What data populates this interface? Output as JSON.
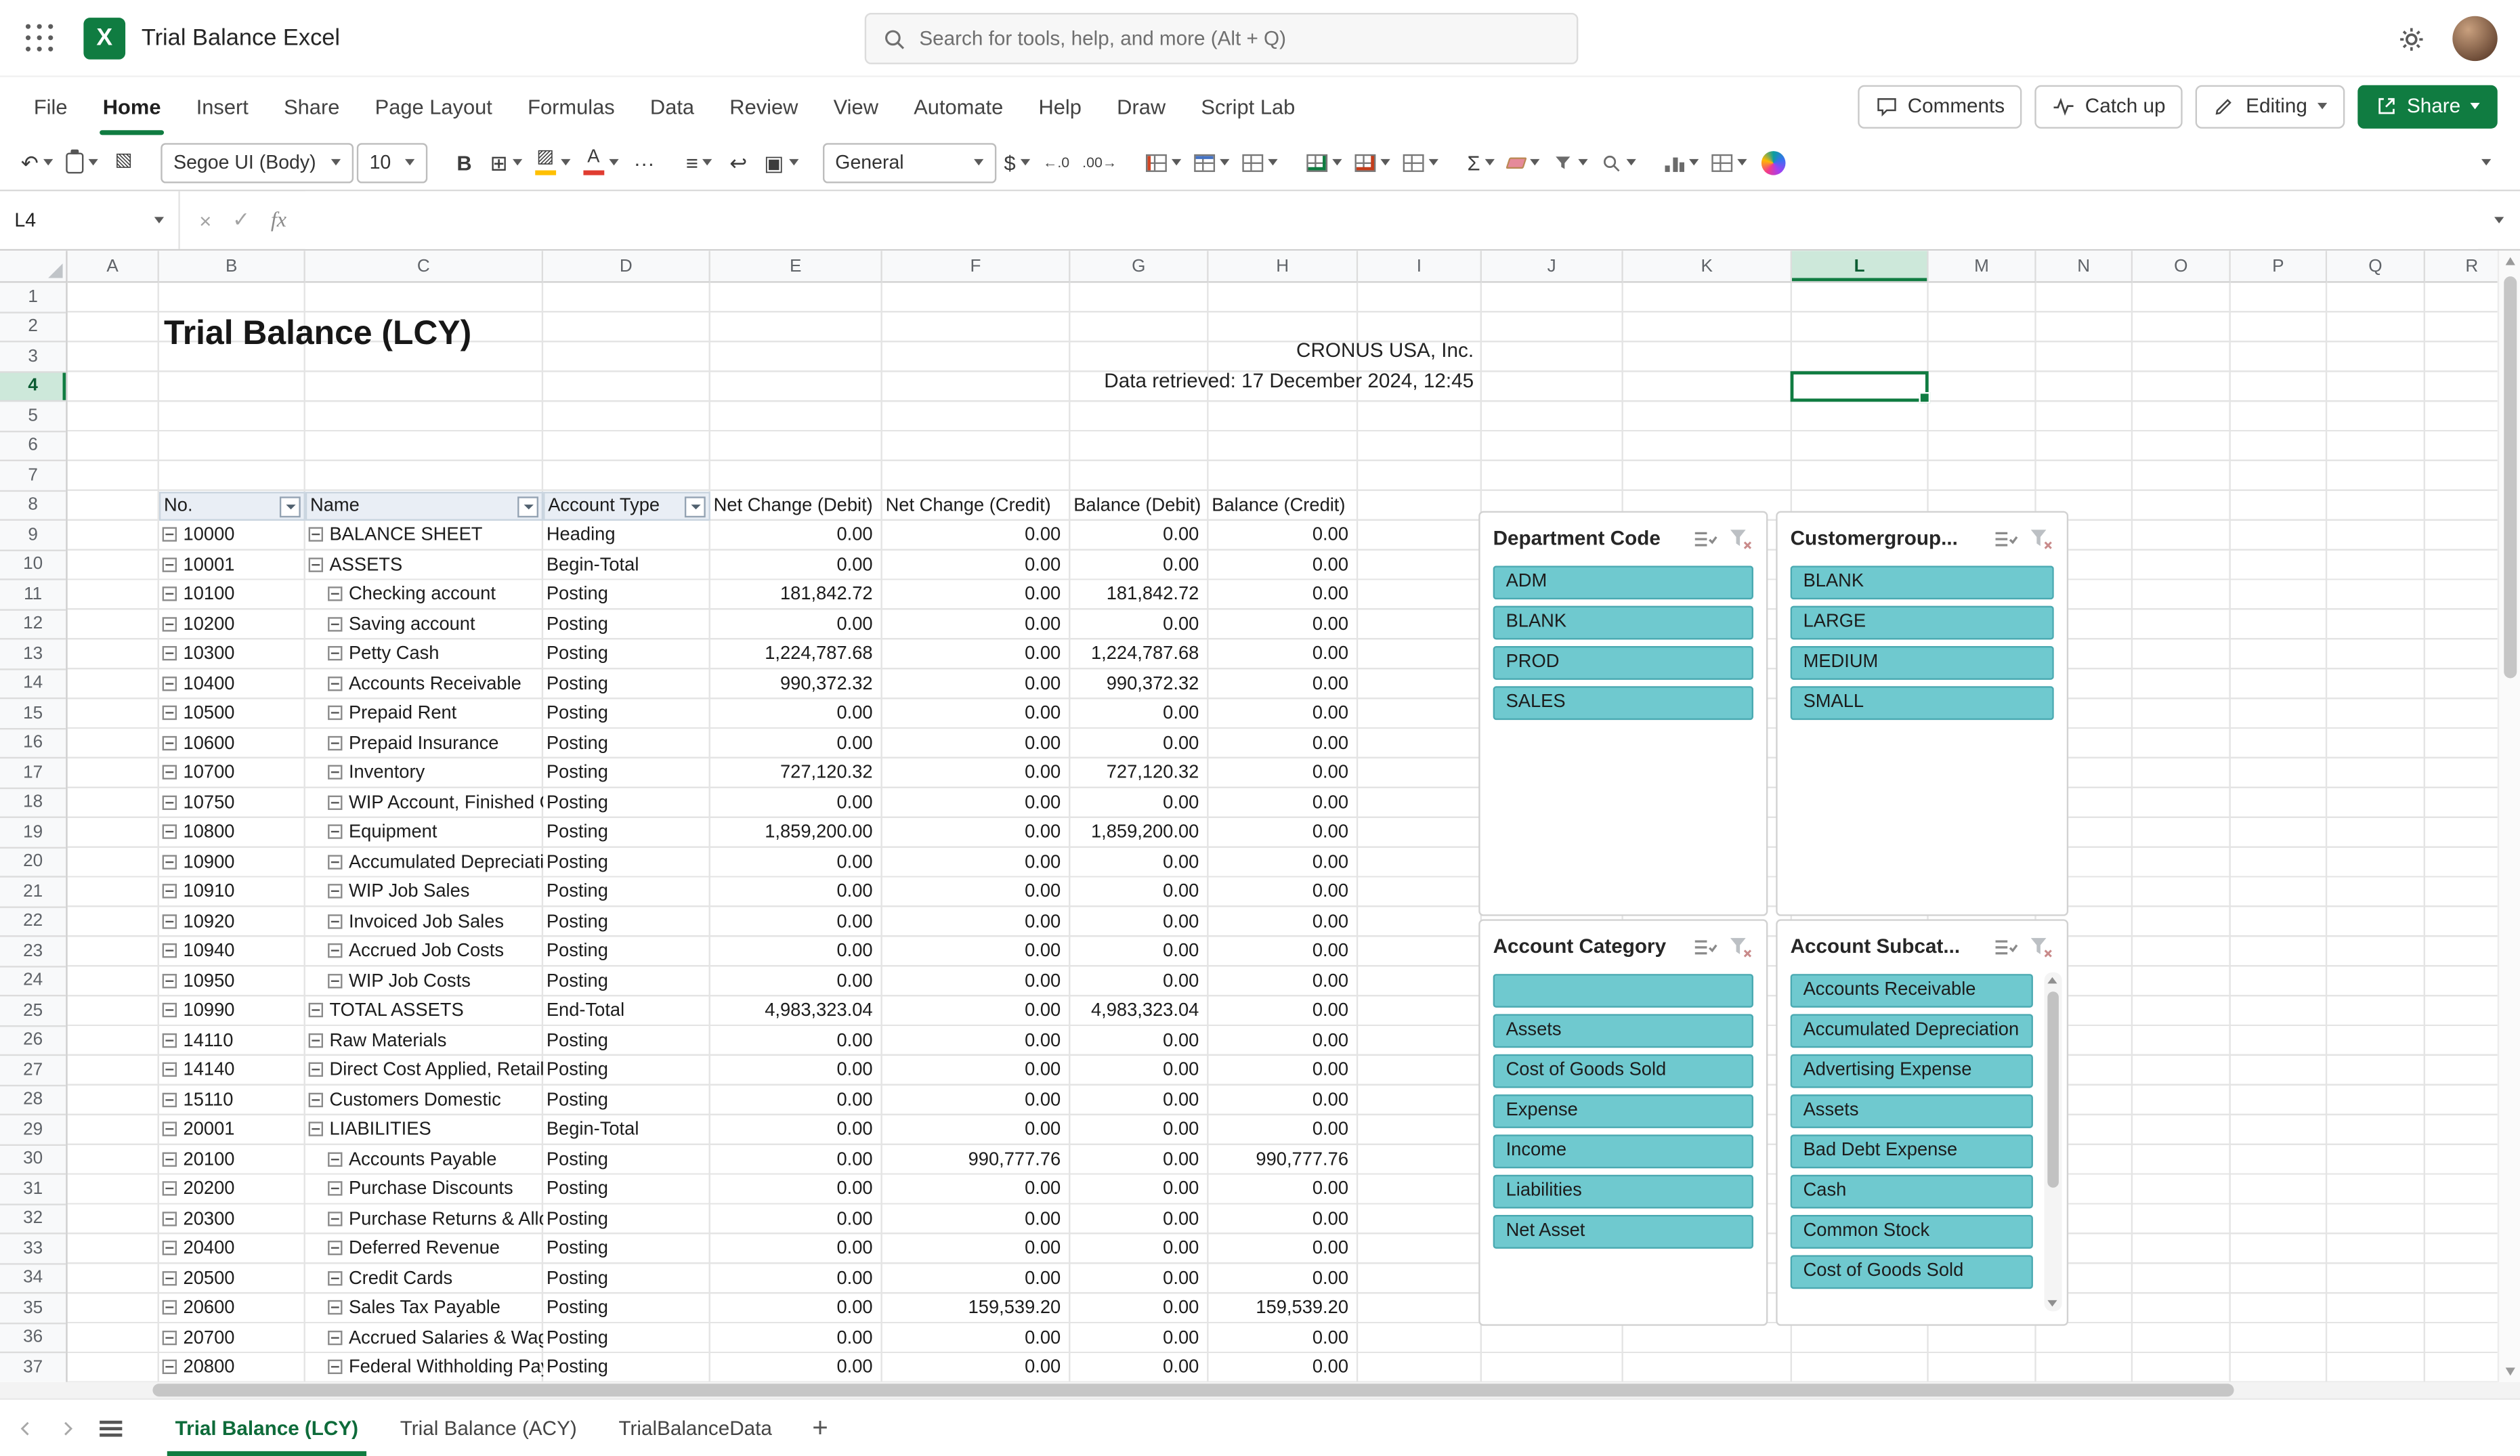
{
  "topbar": {
    "app_title": "Trial Balance Excel",
    "search_placeholder": "Search for tools, help, and more (Alt + Q)"
  },
  "ribbon": {
    "tabs": [
      "File",
      "Home",
      "Insert",
      "Share",
      "Page Layout",
      "Formulas",
      "Data",
      "Review",
      "View",
      "Automate",
      "Help",
      "Draw",
      "Script Lab"
    ],
    "active_tab": "Home",
    "comments_label": "Comments",
    "catchup_label": "Catch up",
    "editing_label": "Editing",
    "share_label": "Share",
    "font_name": "Segoe UI (Body)",
    "font_size": "10",
    "number_format": "General",
    "bold_label": "B",
    "icons": [
      "undo-icon",
      "clipboard-icon",
      "format-painter-icon",
      "borders-icon",
      "fill-color-icon",
      "font-color-icon",
      "more-options-icon",
      "alignment-icon",
      "wrap-text-icon",
      "merge-center-icon",
      "accounting-format-icon",
      "increase-decimal-icon",
      "decrease-decimal-icon",
      "conditional-formatting-icon",
      "format-as-table-icon",
      "cell-styles-icon",
      "insert-cells-icon",
      "delete-cells-icon",
      "format-cells-icon",
      "autosum-icon",
      "clear-icon",
      "sort-filter-icon",
      "find-icon",
      "chart-icon",
      "table-view-icon",
      "copilot-icon",
      "ribbon-collapse-icon"
    ]
  },
  "formula_bar": {
    "name_box": "L4",
    "formula": ""
  },
  "sheet": {
    "title": "Trial Balance (LCY)",
    "company": "CRONUS USA, Inc.",
    "retrieved": "Data retrieved: 17 December 2024, 12:45",
    "selected_cell": "L4",
    "selected_column": "L",
    "selected_row": 4,
    "visible_rows": 37
  },
  "table": {
    "headers": [
      "No.",
      "Name",
      "Account Type",
      "Net Change (Debit)",
      "Net Change (Credit)",
      "Balance (Debit)",
      "Balance (Credit)"
    ],
    "rows": [
      {
        "no": "10000",
        "name": "BALANCE SHEET",
        "indent": 0,
        "type": "Heading",
        "values": [
          "0.00",
          "0.00",
          "0.00",
          "0.00"
        ]
      },
      {
        "no": "10001",
        "name": "ASSETS",
        "indent": 0,
        "type": "Begin-Total",
        "values": [
          "0.00",
          "0.00",
          "0.00",
          "0.00"
        ]
      },
      {
        "no": "10100",
        "name": "Checking account",
        "indent": 1,
        "type": "Posting",
        "values": [
          "181,842.72",
          "0.00",
          "181,842.72",
          "0.00"
        ]
      },
      {
        "no": "10200",
        "name": "Saving account",
        "indent": 1,
        "type": "Posting",
        "values": [
          "0.00",
          "0.00",
          "0.00",
          "0.00"
        ]
      },
      {
        "no": "10300",
        "name": "Petty Cash",
        "indent": 1,
        "type": "Posting",
        "values": [
          "1,224,787.68",
          "0.00",
          "1,224,787.68",
          "0.00"
        ]
      },
      {
        "no": "10400",
        "name": "Accounts Receivable",
        "indent": 1,
        "type": "Posting",
        "values": [
          "990,372.32",
          "0.00",
          "990,372.32",
          "0.00"
        ]
      },
      {
        "no": "10500",
        "name": "Prepaid Rent",
        "indent": 1,
        "type": "Posting",
        "values": [
          "0.00",
          "0.00",
          "0.00",
          "0.00"
        ]
      },
      {
        "no": "10600",
        "name": "Prepaid Insurance",
        "indent": 1,
        "type": "Posting",
        "values": [
          "0.00",
          "0.00",
          "0.00",
          "0.00"
        ]
      },
      {
        "no": "10700",
        "name": "Inventory",
        "indent": 1,
        "type": "Posting",
        "values": [
          "727,120.32",
          "0.00",
          "727,120.32",
          "0.00"
        ]
      },
      {
        "no": "10750",
        "name": "WIP Account, Finished Goods",
        "indent": 1,
        "type": "Posting",
        "values": [
          "0.00",
          "0.00",
          "0.00",
          "0.00"
        ]
      },
      {
        "no": "10800",
        "name": "Equipment",
        "indent": 1,
        "type": "Posting",
        "values": [
          "1,859,200.00",
          "0.00",
          "1,859,200.00",
          "0.00"
        ]
      },
      {
        "no": "10900",
        "name": "Accumulated Depreciation",
        "indent": 1,
        "type": "Posting",
        "values": [
          "0.00",
          "0.00",
          "0.00",
          "0.00"
        ]
      },
      {
        "no": "10910",
        "name": "WIP Job Sales",
        "indent": 1,
        "type": "Posting",
        "values": [
          "0.00",
          "0.00",
          "0.00",
          "0.00"
        ]
      },
      {
        "no": "10920",
        "name": "Invoiced Job Sales",
        "indent": 1,
        "type": "Posting",
        "values": [
          "0.00",
          "0.00",
          "0.00",
          "0.00"
        ]
      },
      {
        "no": "10940",
        "name": "Accrued Job Costs",
        "indent": 1,
        "type": "Posting",
        "values": [
          "0.00",
          "0.00",
          "0.00",
          "0.00"
        ]
      },
      {
        "no": "10950",
        "name": "WIP Job Costs",
        "indent": 1,
        "type": "Posting",
        "values": [
          "0.00",
          "0.00",
          "0.00",
          "0.00"
        ]
      },
      {
        "no": "10990",
        "name": "TOTAL ASSETS",
        "indent": 0,
        "type": "End-Total",
        "values": [
          "4,983,323.04",
          "0.00",
          "4,983,323.04",
          "0.00"
        ]
      },
      {
        "no": "14110",
        "name": "Raw Materials",
        "indent": 0,
        "type": "Posting",
        "values": [
          "0.00",
          "0.00",
          "0.00",
          "0.00"
        ]
      },
      {
        "no": "14140",
        "name": "Direct Cost Applied, Retail",
        "indent": 0,
        "type": "Posting",
        "values": [
          "0.00",
          "0.00",
          "0.00",
          "0.00"
        ]
      },
      {
        "no": "15110",
        "name": "Customers Domestic",
        "indent": 0,
        "type": "Posting",
        "values": [
          "0.00",
          "0.00",
          "0.00",
          "0.00"
        ]
      },
      {
        "no": "20001",
        "name": "LIABILITIES",
        "indent": 0,
        "type": "Begin-Total",
        "values": [
          "0.00",
          "0.00",
          "0.00",
          "0.00"
        ]
      },
      {
        "no": "20100",
        "name": "Accounts Payable",
        "indent": 1,
        "type": "Posting",
        "values": [
          "0.00",
          "990,777.76",
          "0.00",
          "990,777.76"
        ]
      },
      {
        "no": "20200",
        "name": "Purchase Discounts",
        "indent": 1,
        "type": "Posting",
        "values": [
          "0.00",
          "0.00",
          "0.00",
          "0.00"
        ]
      },
      {
        "no": "20300",
        "name": "Purchase Returns & Allowances",
        "indent": 1,
        "type": "Posting",
        "values": [
          "0.00",
          "0.00",
          "0.00",
          "0.00"
        ]
      },
      {
        "no": "20400",
        "name": "Deferred Revenue",
        "indent": 1,
        "type": "Posting",
        "values": [
          "0.00",
          "0.00",
          "0.00",
          "0.00"
        ]
      },
      {
        "no": "20500",
        "name": "Credit Cards",
        "indent": 1,
        "type": "Posting",
        "values": [
          "0.00",
          "0.00",
          "0.00",
          "0.00"
        ]
      },
      {
        "no": "20600",
        "name": "Sales Tax Payable",
        "indent": 1,
        "type": "Posting",
        "values": [
          "0.00",
          "159,539.20",
          "0.00",
          "159,539.20"
        ]
      },
      {
        "no": "20700",
        "name": "Accrued Salaries & Wages",
        "indent": 1,
        "type": "Posting",
        "values": [
          "0.00",
          "0.00",
          "0.00",
          "0.00"
        ]
      },
      {
        "no": "20800",
        "name": "Federal Withholding Payable",
        "indent": 1,
        "type": "Posting",
        "values": [
          "0.00",
          "0.00",
          "0.00",
          "0.00"
        ]
      }
    ]
  },
  "slicers": [
    {
      "title": "Department Code",
      "icons": [
        "multi-select-icon",
        "clear-filter-icon"
      ],
      "items": [
        "ADM",
        "BLANK",
        "PROD",
        "SALES"
      ]
    },
    {
      "title": "Customergroup...",
      "icons": [
        "multi-select-icon",
        "clear-filter-icon"
      ],
      "items": [
        "BLANK",
        "LARGE",
        "MEDIUM",
        "SMALL"
      ]
    },
    {
      "title": "Account Category",
      "icons": [
        "multi-select-icon",
        "clear-filter-icon"
      ],
      "items": [
        "",
        "Assets",
        "Cost of Goods Sold",
        "Expense",
        "Income",
        "Liabilities",
        "Net Asset"
      ]
    },
    {
      "title": "Account Subcat...",
      "icons": [
        "multi-select-icon",
        "clear-filter-icon"
      ],
      "has_scrollbar": true,
      "items": [
        "Accounts Receivable",
        "Accumulated Depreciation",
        "Advertising Expense",
        "Assets",
        "Bad Debt Expense",
        "Cash",
        "Common Stock",
        "Cost of Goods Sold"
      ]
    }
  ],
  "sheet_bar": {
    "tabs": [
      {
        "label": "Trial Balance (LCY)",
        "active": true
      },
      {
        "label": "Trial Balance (ACY)",
        "active": false
      },
      {
        "label": "TrialBalanceData",
        "active": false
      }
    ],
    "add_label": "+"
  }
}
